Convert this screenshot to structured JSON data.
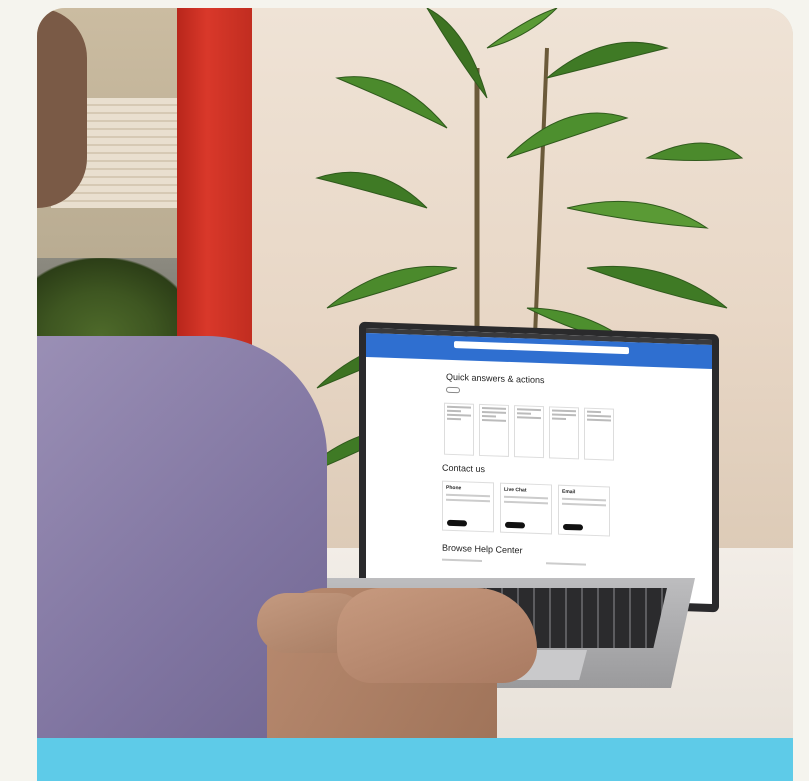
{
  "photo": {
    "background_color": "#f5f4ee",
    "accent_strip_color": "#5ecbe8"
  },
  "laptop_screen": {
    "header_color": "#2f6fd0",
    "search_placeholder": "",
    "header_link": "",
    "section1_title": "Quick answers & actions",
    "pills": [
      "",
      "",
      "",
      ""
    ],
    "cards_count_note": "",
    "section2_title": "Contact us",
    "contact_boxes": [
      {
        "label": "Phone"
      },
      {
        "label": "Live Chat"
      },
      {
        "label": "Email"
      }
    ],
    "section3_title": "Browse Help Center"
  }
}
